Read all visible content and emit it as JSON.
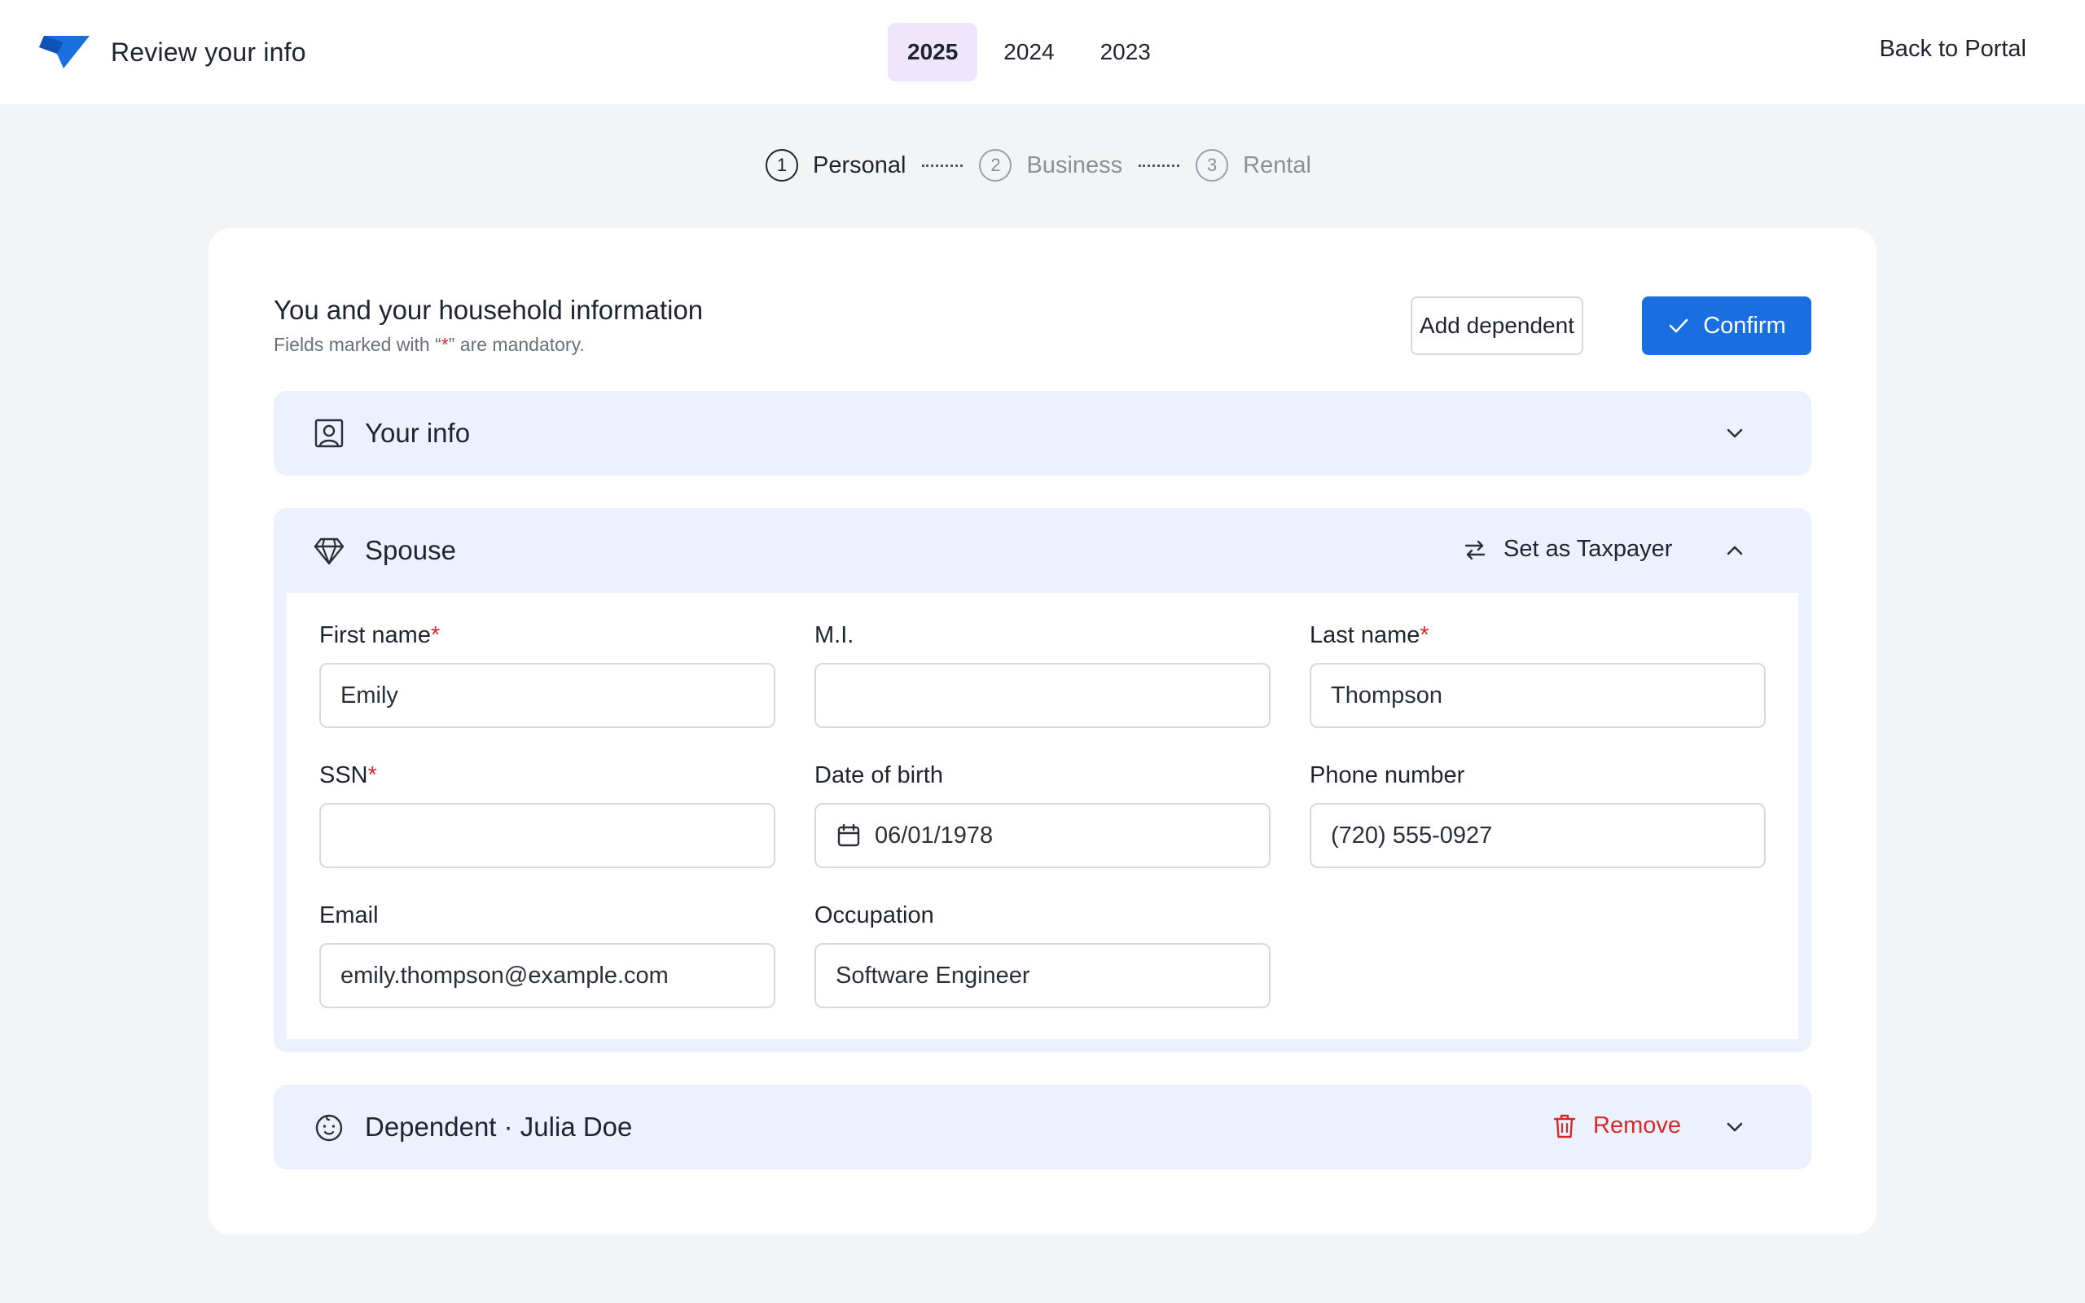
{
  "header": {
    "title": "Review your info",
    "years": [
      "2025",
      "2024",
      "2023"
    ],
    "active_year": "2025",
    "back_link": "Back to Portal"
  },
  "stepper": {
    "steps": [
      {
        "num": "1",
        "label": "Personal",
        "active": true
      },
      {
        "num": "2",
        "label": "Business",
        "active": false
      },
      {
        "num": "3",
        "label": "Rental",
        "active": false
      }
    ]
  },
  "card": {
    "title": "You and your household information",
    "subtitle_prefix": "Fields marked with “",
    "subtitle_star": "*",
    "subtitle_suffix": "” are mandatory.",
    "add_dependent": "Add dependent",
    "confirm": "Confirm"
  },
  "sections": {
    "your_info": {
      "title": "Your info",
      "icon": "user-square-icon",
      "expanded": false
    },
    "spouse": {
      "title": "Spouse",
      "icon": "diamond-icon",
      "set_taxpayer": "Set as Taxpayer",
      "expanded": true,
      "fields": {
        "first_name": {
          "label": "First name",
          "required": "*",
          "value": "Emily"
        },
        "mi": {
          "label": "M.I.",
          "value": ""
        },
        "last_name": {
          "label": "Last name",
          "required": "*",
          "value": "Thompson"
        },
        "ssn": {
          "label": "SSN",
          "required": "*",
          "value": ""
        },
        "dob": {
          "label": "Date of birth",
          "value": "06/01/1978"
        },
        "phone": {
          "label": "Phone number",
          "value": "(720) 555-0927"
        },
        "email": {
          "label": "Email",
          "value": "emily.thompson@example.com"
        },
        "occupation": {
          "label": "Occupation",
          "value": "Software Engineer"
        }
      }
    },
    "dependent": {
      "title": "Dependent · Julia Doe",
      "icon": "baby-face-icon",
      "remove": "Remove",
      "expanded": false
    }
  },
  "colors": {
    "accent": "#1a6fe0",
    "active_year_bg": "#efe6fb",
    "section_bg": "#ecf1fd",
    "danger": "#d42a2a",
    "page_bg": "#f3f4f6"
  }
}
